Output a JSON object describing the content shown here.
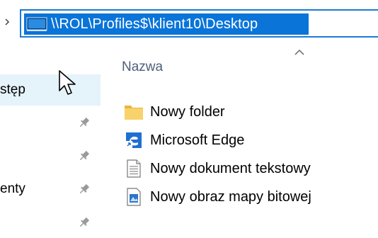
{
  "address_bar": {
    "path": "\\\\ROL\\Profiles$\\klient10\\Desktop",
    "icon": "network-folder-icon",
    "chevron_icon": "chevron-right-icon"
  },
  "column_header": {
    "name_label": "Nazwa",
    "sort_icon": "sort-ascending-icon"
  },
  "navigation": {
    "items": [
      {
        "label": "stęp",
        "pinned": false
      },
      {
        "label": "",
        "pinned": true
      },
      {
        "label": "",
        "pinned": true
      },
      {
        "label": "enty",
        "pinned": true
      },
      {
        "label": "",
        "pinned": true
      }
    ]
  },
  "files": [
    {
      "name": "Nowy folder",
      "icon": "folder-icon"
    },
    {
      "name": "Microsoft Edge",
      "icon": "edge-shortcut-icon"
    },
    {
      "name": "Nowy dokument tekstowy",
      "icon": "text-document-icon"
    },
    {
      "name": "Nowy obraz mapy bitowej",
      "icon": "bitmap-image-icon"
    }
  ],
  "colors": {
    "selection": "#0a74d8",
    "address_border": "#1b7bd6",
    "hover": "#e5f3fb",
    "header_text": "#4c607a",
    "folder": "#f5c85a"
  }
}
